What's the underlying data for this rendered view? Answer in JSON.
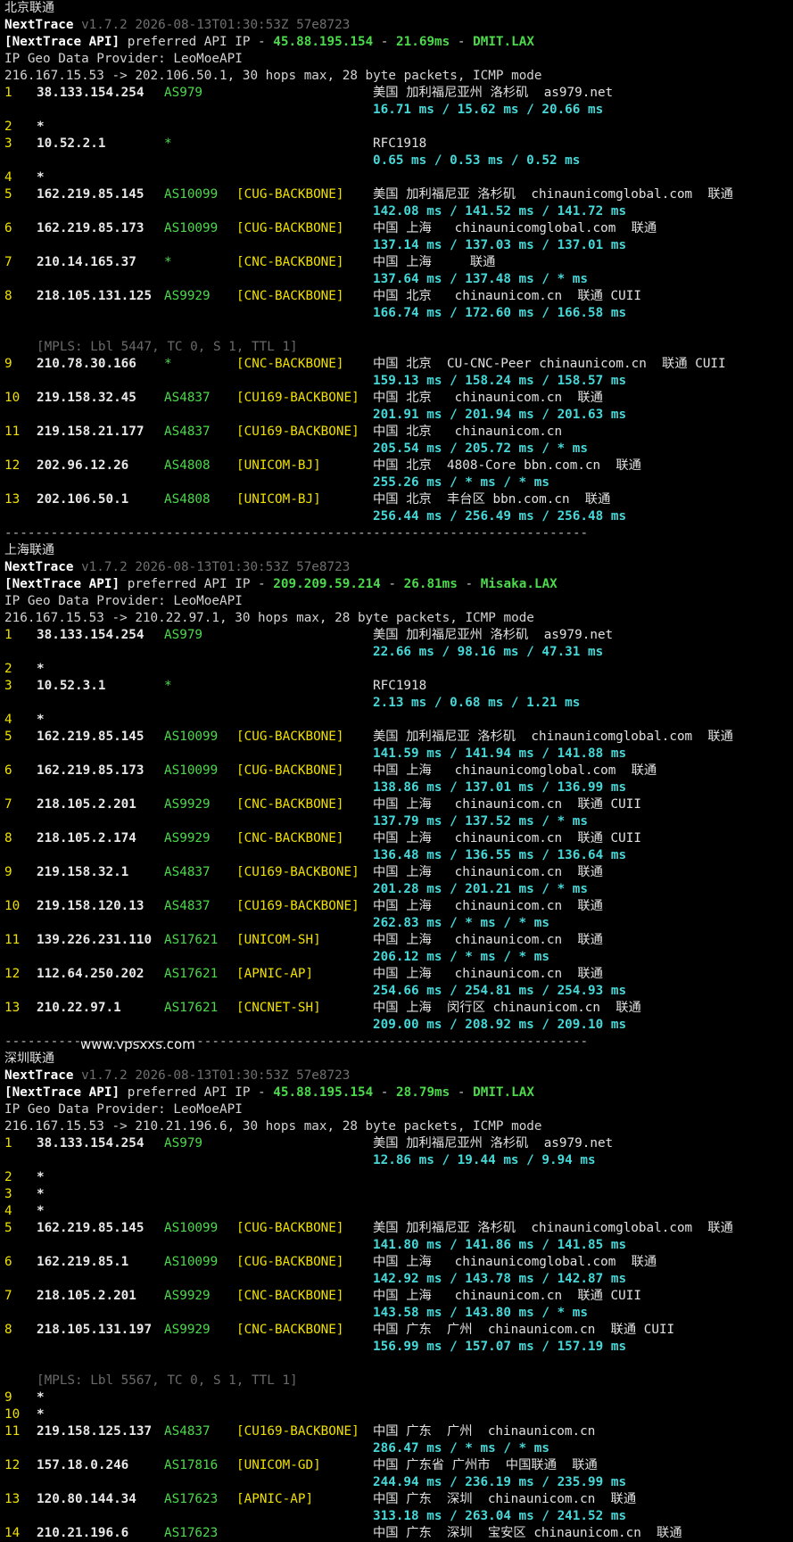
{
  "sections": [
    {
      "title": "北京联通",
      "product": "NextTrace",
      "version_line": " v1.7.2 2026-08-13T01:30:53Z 57e8723",
      "api_prefix": "[NextTrace API]",
      "api_mid": " preferred API IP - ",
      "api_ip": "45.88.195.154",
      "api_dash": " - ",
      "api_latency": "21.69ms",
      "api_dash2": " - ",
      "api_node": "DMIT.LAX",
      "geo_provider": "IP Geo Data Provider: LeoMoeAPI",
      "route_line": "216.167.15.53 -> 202.106.50.1, 30 hops max, 28 byte packets, ICMP mode",
      "hops": [
        {
          "n": "1",
          "ip": "38.133.154.254",
          "as": "AS979",
          "tag": "",
          "geo": "美国 加利福尼亚州 洛杉矶  as979.net",
          "lat": "16.71 ms / 15.62 ms / 20.66 ms"
        },
        {
          "n": "2",
          "ip": "*"
        },
        {
          "n": "3",
          "ip": "10.52.2.1",
          "as": "*",
          "tag": "",
          "geo": "RFC1918",
          "lat": "0.65 ms / 0.53 ms / 0.52 ms"
        },
        {
          "n": "4",
          "ip": "*"
        },
        {
          "n": "5",
          "ip": "162.219.85.145",
          "as": "AS10099",
          "tag": "[CUG-BACKBONE]",
          "geo": "美国 加利福尼亚 洛杉矶  chinaunicomglobal.com  联通",
          "lat": "142.08 ms / 141.52 ms / 141.72 ms"
        },
        {
          "n": "6",
          "ip": "162.219.85.173",
          "as": "AS10099",
          "tag": "[CUG-BACKBONE]",
          "geo": "中国 上海   chinaunicomglobal.com  联通",
          "lat": "137.14 ms / 137.03 ms / 137.01 ms"
        },
        {
          "n": "7",
          "ip": "210.14.165.37",
          "as": "*",
          "tag": "[CNC-BACKBONE]",
          "geo": "中国 上海     联通",
          "lat": "137.64 ms / 137.48 ms / * ms"
        },
        {
          "n": "8",
          "ip": "218.105.131.125",
          "as": "AS9929",
          "tag": "[CNC-BACKBONE]",
          "geo": "中国 北京   chinaunicom.cn  联通 CUII",
          "lat": "166.74 ms / 172.60 ms / 166.58 ms",
          "mpls": "[MPLS: Lbl 5447, TC 0, S 1, TTL 1]"
        },
        {
          "n": "9",
          "ip": "210.78.30.166",
          "as": "*",
          "tag": "[CNC-BACKBONE]",
          "geo": "中国 北京  CU-CNC-Peer chinaunicom.cn  联通 CUII",
          "lat": "159.13 ms / 158.24 ms / 158.57 ms"
        },
        {
          "n": "10",
          "ip": "219.158.32.45",
          "as": "AS4837",
          "tag": "[CU169-BACKBONE]",
          "geo": "中国 北京   chinaunicom.cn  联通",
          "lat": "201.91 ms / 201.94 ms / 201.63 ms"
        },
        {
          "n": "11",
          "ip": "219.158.21.177",
          "as": "AS4837",
          "tag": "[CU169-BACKBONE]",
          "geo": "中国 北京   chinaunicom.cn",
          "lat": "205.54 ms / 205.72 ms / * ms"
        },
        {
          "n": "12",
          "ip": "202.96.12.26",
          "as": "AS4808",
          "tag": "[UNICOM-BJ]",
          "geo": "中国 北京  4808-Core bbn.com.cn  联通",
          "lat": "255.26 ms / * ms / * ms"
        },
        {
          "n": "13",
          "ip": "202.106.50.1",
          "as": "AS4808",
          "tag": "[UNICOM-BJ]",
          "geo": "中国 北京  丰台区 bbn.com.cn  联通",
          "lat": "256.44 ms / 256.49 ms / 256.48 ms"
        }
      ]
    },
    {
      "title": "上海联通",
      "product": "NextTrace",
      "version_line": " v1.7.2 2026-08-13T01:30:53Z 57e8723",
      "api_prefix": "[NextTrace API]",
      "api_mid": " preferred API IP - ",
      "api_ip": "209.209.59.214",
      "api_dash": " - ",
      "api_latency": "26.81ms",
      "api_dash2": " - ",
      "api_node": "Misaka.LAX",
      "geo_provider": "IP Geo Data Provider: LeoMoeAPI",
      "route_line": "216.167.15.53 -> 210.22.97.1, 30 hops max, 28 byte packets, ICMP mode",
      "hops": [
        {
          "n": "1",
          "ip": "38.133.154.254",
          "as": "AS979",
          "tag": "",
          "geo": "美国 加利福尼亚州 洛杉矶  as979.net",
          "lat": "22.66 ms / 98.16 ms / 47.31 ms"
        },
        {
          "n": "2",
          "ip": "*"
        },
        {
          "n": "3",
          "ip": "10.52.3.1",
          "as": "*",
          "tag": "",
          "geo": "RFC1918",
          "lat": "2.13 ms / 0.68 ms / 1.21 ms"
        },
        {
          "n": "4",
          "ip": "*"
        },
        {
          "n": "5",
          "ip": "162.219.85.145",
          "as": "AS10099",
          "tag": "[CUG-BACKBONE]",
          "geo": "美国 加利福尼亚 洛杉矶  chinaunicomglobal.com  联通",
          "lat": "141.59 ms / 141.94 ms / 141.88 ms"
        },
        {
          "n": "6",
          "ip": "162.219.85.173",
          "as": "AS10099",
          "tag": "[CUG-BACKBONE]",
          "geo": "中国 上海   chinaunicomglobal.com  联通",
          "lat": "138.86 ms / 137.01 ms / 136.99 ms"
        },
        {
          "n": "7",
          "ip": "218.105.2.201",
          "as": "AS9929",
          "tag": "[CNC-BACKBONE]",
          "geo": "中国 上海   chinaunicom.cn  联通 CUII",
          "lat": "137.79 ms / 137.52 ms / * ms"
        },
        {
          "n": "8",
          "ip": "218.105.2.174",
          "as": "AS9929",
          "tag": "[CNC-BACKBONE]",
          "geo": "中国 上海   chinaunicom.cn  联通 CUII",
          "lat": "136.48 ms / 136.55 ms / 136.64 ms"
        },
        {
          "n": "9",
          "ip": "219.158.32.1",
          "as": "AS4837",
          "tag": "[CU169-BACKBONE]",
          "geo": "中国 上海   chinaunicom.cn  联通",
          "lat": "201.28 ms / 201.21 ms / * ms"
        },
        {
          "n": "10",
          "ip": "219.158.120.13",
          "as": "AS4837",
          "tag": "[CU169-BACKBONE]",
          "geo": "中国 上海   chinaunicom.cn  联通",
          "lat": "262.83 ms / * ms / * ms"
        },
        {
          "n": "11",
          "ip": "139.226.231.110",
          "as": "AS17621",
          "tag": "[UNICOM-SH]",
          "geo": "中国 上海   chinaunicom.cn  联通",
          "lat": "206.12 ms / * ms / * ms"
        },
        {
          "n": "12",
          "ip": "112.64.250.202",
          "as": "AS17621",
          "tag": "[APNIC-AP]",
          "geo": "中国 上海   chinaunicom.cn  联通",
          "lat": "254.66 ms / 254.81 ms / 254.93 ms"
        },
        {
          "n": "13",
          "ip": "210.22.97.1",
          "as": "AS17621",
          "tag": "[CNCNET-SH]",
          "geo": "中国 上海  闵行区 chinaunicom.cn  联通",
          "lat": "209.00 ms / 208.92 ms / 209.10 ms"
        }
      ]
    },
    {
      "title": "深圳联通",
      "product": "NextTrace",
      "version_line": " v1.7.2 2026-08-13T01:30:53Z 57e8723",
      "api_prefix": "[NextTrace API]",
      "api_mid": " preferred API IP - ",
      "api_ip": "45.88.195.154",
      "api_dash": " - ",
      "api_latency": "28.79ms",
      "api_dash2": " - ",
      "api_node": "DMIT.LAX",
      "geo_provider": "IP Geo Data Provider: LeoMoeAPI",
      "route_line": "216.167.15.53 -> 210.21.196.6, 30 hops max, 28 byte packets, ICMP mode",
      "hops": [
        {
          "n": "1",
          "ip": "38.133.154.254",
          "as": "AS979",
          "tag": "",
          "geo": "美国 加利福尼亚州 洛杉矶  as979.net",
          "lat": "12.86 ms / 19.44 ms / 9.94 ms"
        },
        {
          "n": "2",
          "ip": "*"
        },
        {
          "n": "3",
          "ip": "*"
        },
        {
          "n": "4",
          "ip": "*"
        },
        {
          "n": "5",
          "ip": "162.219.85.145",
          "as": "AS10099",
          "tag": "[CUG-BACKBONE]",
          "geo": "美国 加利福尼亚 洛杉矶  chinaunicomglobal.com  联通",
          "lat": "141.80 ms / 141.86 ms / 141.85 ms"
        },
        {
          "n": "6",
          "ip": "162.219.85.1",
          "as": "AS10099",
          "tag": "[CUG-BACKBONE]",
          "geo": "中国 上海   chinaunicomglobal.com  联通",
          "lat": "142.92 ms / 143.78 ms / 142.87 ms"
        },
        {
          "n": "7",
          "ip": "218.105.2.201",
          "as": "AS9929",
          "tag": "[CNC-BACKBONE]",
          "geo": "中国 上海   chinaunicom.cn  联通 CUII",
          "lat": "143.58 ms / 143.80 ms / * ms"
        },
        {
          "n": "8",
          "ip": "218.105.131.197",
          "as": "AS9929",
          "tag": "[CNC-BACKBONE]",
          "geo": "中国 广东  广州  chinaunicom.cn  联通 CUII",
          "lat": "156.99 ms / 157.07 ms / 157.19 ms",
          "mpls": "[MPLS: Lbl 5567, TC 0, S 1, TTL 1]"
        },
        {
          "n": "9",
          "ip": "*"
        },
        {
          "n": "10",
          "ip": "*"
        },
        {
          "n": "11",
          "ip": "219.158.125.137",
          "as": "AS4837",
          "tag": "[CU169-BACKBONE]",
          "geo": "中国 广东  广州  chinaunicom.cn",
          "lat": "286.47 ms / * ms / * ms"
        },
        {
          "n": "12",
          "ip": "157.18.0.246",
          "as": "AS17816",
          "tag": "[UNICOM-GD]",
          "geo": "中国 广东省 广州市  中国联通  联通",
          "lat": "244.94 ms / 236.19 ms / 235.99 ms"
        },
        {
          "n": "13",
          "ip": "120.80.144.34",
          "as": "AS17623",
          "tag": "[APNIC-AP]",
          "geo": "中国 广东  深圳  chinaunicom.cn  联通",
          "lat": "313.18 ms / 263.04 ms / 241.52 ms"
        },
        {
          "n": "14",
          "ip": "210.21.196.6",
          "as": "AS17623",
          "tag": "",
          "geo": "中国 广东  深圳  宝安区 chinaunicom.cn  联通",
          "lat": ""
        }
      ]
    }
  ],
  "separator": "----------------------------------------------------------------------------",
  "watermark": "www.vpsxxs.com"
}
